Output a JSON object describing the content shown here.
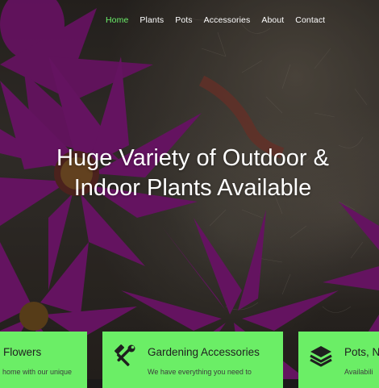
{
  "nav": {
    "items": [
      "Home",
      "Plants",
      "Pots",
      "Accessories",
      "About",
      "Contact"
    ],
    "active_color": "#6cf06a"
  },
  "hero": {
    "line1": "Huge Variety of Outdoor &",
    "line2": "Indoor Plants Available",
    "flower_color": "#7a1774"
  },
  "features": [
    {
      "title": "Flowers",
      "desc": "home with our unique",
      "icon": "none"
    },
    {
      "title": "Gardening Accessories",
      "desc": "We have everything you need to",
      "icon": "tools-icon"
    },
    {
      "title": "Pots, Ne",
      "desc": "Availabili",
      "icon": "layers-icon"
    }
  ],
  "card_color": "#6bee66"
}
